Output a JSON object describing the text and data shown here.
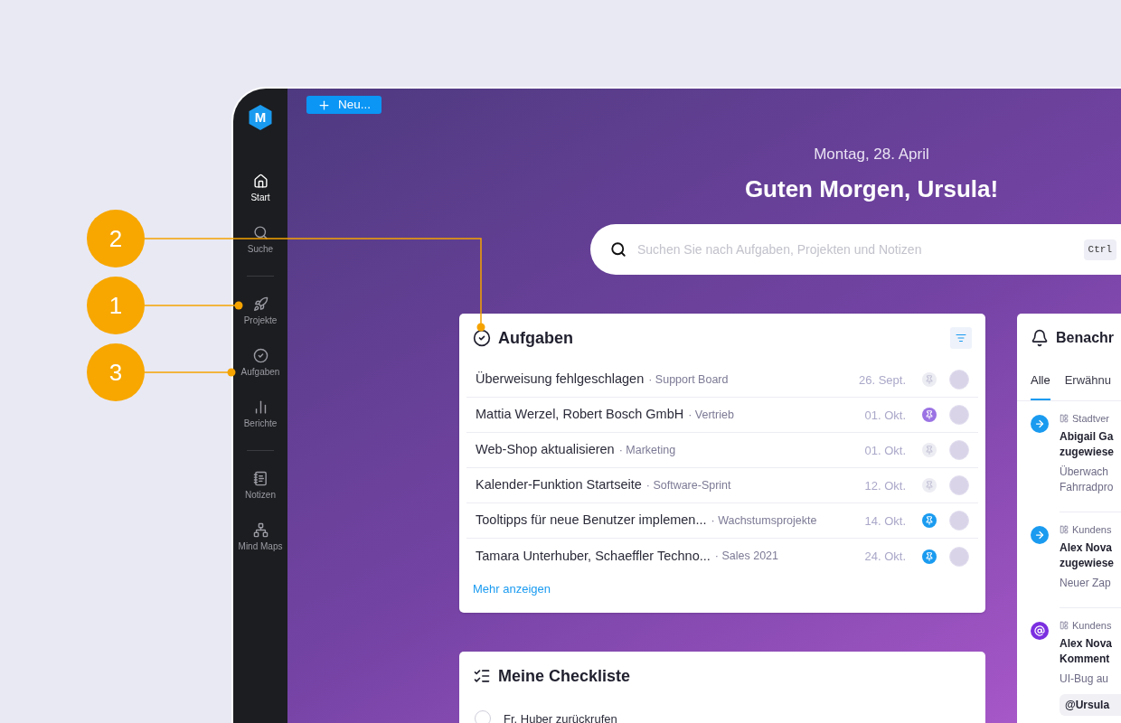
{
  "callouts": [
    {
      "label": "2"
    },
    {
      "label": "1"
    },
    {
      "label": "3"
    }
  ],
  "sidebar": {
    "logo": "M",
    "groups": [
      {
        "items": [
          {
            "label": "Start",
            "selected": true
          },
          {
            "label": "Suche",
            "selected": false
          }
        ]
      },
      {
        "items": [
          {
            "label": "Projekte",
            "selected": false
          },
          {
            "label": "Aufgaben",
            "selected": false
          },
          {
            "label": "Berichte",
            "selected": false
          }
        ]
      },
      {
        "items": [
          {
            "label": "Notizen",
            "selected": false
          },
          {
            "label": "Mind Maps",
            "selected": false
          }
        ]
      }
    ]
  },
  "new_button": "Neu...",
  "date": "Montag, 28. April",
  "greeting": "Guten Morgen, Ursula!",
  "search": {
    "placeholder": "Suchen Sie nach Aufgaben, Projekten und Notizen",
    "shortcut": "Ctrl"
  },
  "tasks": {
    "title": "Aufgaben",
    "more": "Mehr anzeigen",
    "rows": [
      {
        "title": "Überweisung fehlgeschlagen",
        "project": "· Support Board",
        "date": "26. Sept.",
        "pinned": false,
        "color": "#ececf3"
      },
      {
        "title": "Mattia Werzel, Robert Bosch GmbH",
        "project": "· Vertrieb",
        "date": "01. Okt.",
        "pinned": true,
        "color": "#9b73e3"
      },
      {
        "title": "Web-Shop aktualisieren",
        "project": "· Marketing",
        "date": "01. Okt.",
        "pinned": false,
        "color": "#ececf3"
      },
      {
        "title": "Kalender-Funktion Startseite",
        "project": "· Software-Sprint",
        "date": "12. Okt.",
        "pinned": false,
        "color": "#ececf3"
      },
      {
        "title": "Tooltipps für neue Benutzer implemen...",
        "project": "· Wachstumsprojekte",
        "date": "14. Okt.",
        "pinned": true,
        "color": "#1a9bf0"
      },
      {
        "title": "Tamara Unterhuber, Schaeffler Techno...",
        "project": "· Sales 2021",
        "date": "24. Okt.",
        "pinned": true,
        "color": "#1a9bf0"
      }
    ]
  },
  "checklist": {
    "title": "Meine Checkliste",
    "items": [
      {
        "label": "Fr. Huber zurückrufen",
        "checked": false
      }
    ]
  },
  "notifications": {
    "title": "Benachr",
    "tabs": [
      {
        "label": "Alle",
        "selected": true
      },
      {
        "label": "Erwähnu",
        "selected": false
      }
    ],
    "items": [
      {
        "kind": "assign",
        "project": "Stadtver",
        "title_lines": [
          "Abigail Ga",
          "zugewiese"
        ],
        "body_lines": [
          "Überwach",
          "Fahrradpro"
        ]
      },
      {
        "kind": "assign",
        "project": "Kundens",
        "title_lines": [
          "Alex Nova",
          "zugewiese"
        ],
        "body_lines": [
          "Neuer Zap"
        ]
      },
      {
        "kind": "mention",
        "project": "Kundens",
        "title_lines": [
          "Alex Nova",
          "Komment"
        ],
        "body_lines": [
          "UI-Bug au"
        ],
        "quote": "@Ursula"
      }
    ]
  }
}
